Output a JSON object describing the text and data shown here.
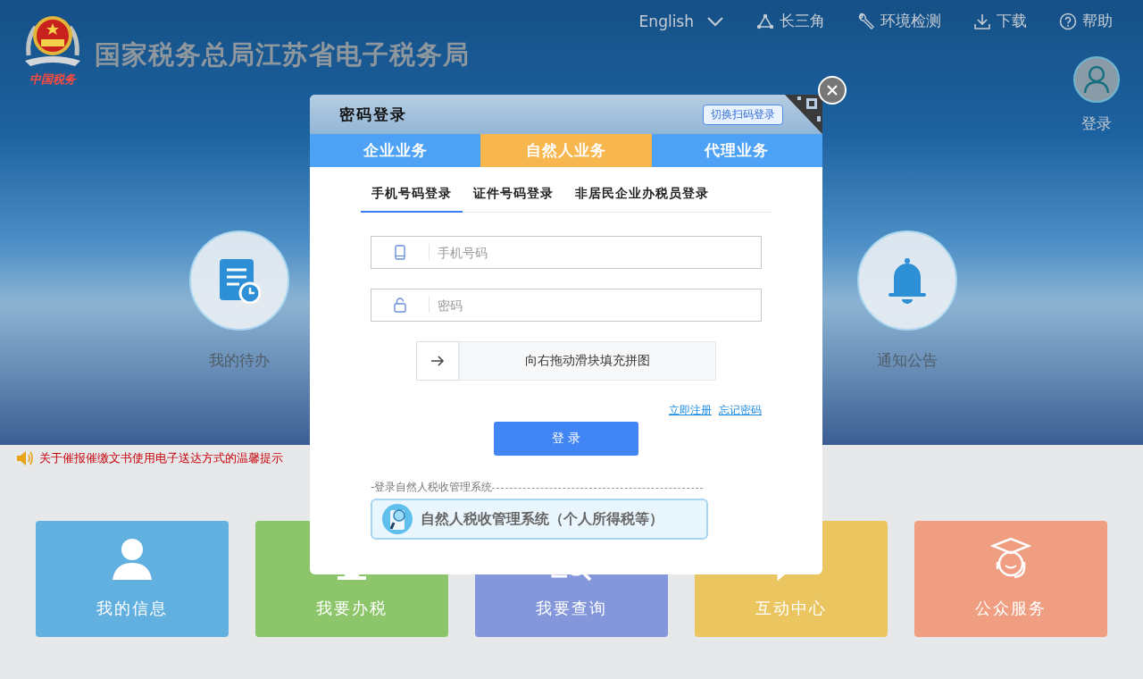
{
  "header": {
    "logo_caption": "中国税务",
    "site_title": "国家税务总局江苏省电子税务局",
    "nav": [
      {
        "kind": "language",
        "label": "English"
      },
      {
        "kind": "triangle",
        "label": "长三角"
      },
      {
        "kind": "wrench",
        "label": "环境检测"
      },
      {
        "kind": "download",
        "label": "下载"
      },
      {
        "kind": "help",
        "label": "帮助"
      }
    ],
    "login_label": "登录"
  },
  "hero": {
    "shortcuts": [
      {
        "kind": "todo",
        "label": "我的待办"
      },
      {
        "kind": "bell",
        "label": "通知公告"
      }
    ]
  },
  "notice": "关于催报催缴文书使用电子送达方式的温馨提示",
  "tiles": [
    {
      "kind": "person",
      "label": "我的信息",
      "color": "#62b0e0"
    },
    {
      "kind": "monitor",
      "label": "我要办税",
      "color": "#8dc66a"
    },
    {
      "kind": "search",
      "label": "我要查询",
      "color": "#8497db"
    },
    {
      "kind": "chat",
      "label": "互动中心",
      "color": "#ebc660"
    },
    {
      "kind": "service",
      "label": "公众服务",
      "color": "#ef9e82"
    }
  ],
  "dialog": {
    "title": "密码登录",
    "switch_label": "切换扫码登录",
    "tabs": [
      {
        "label": "企业业务",
        "selected": false
      },
      {
        "label": "自然人业务",
        "selected": true
      },
      {
        "label": "代理业务",
        "selected": false
      }
    ],
    "login_methods": [
      {
        "label": "手机号码登录",
        "selected": true
      },
      {
        "label": "证件号码登录",
        "selected": false
      },
      {
        "label": "非居民企业办税员登录",
        "selected": false
      }
    ],
    "fields": [
      {
        "kind": "phone",
        "placeholder": "手机号码"
      },
      {
        "kind": "lock",
        "placeholder": "密码"
      }
    ],
    "slider_hint": "向右拖动滑块填充拼图",
    "links": [
      "立即注册",
      "忘记密码"
    ],
    "submit": "登 录",
    "section_label": "-登录自然人税收管理系统",
    "system_button": "自然人税收管理系统（个人所得税等）"
  }
}
